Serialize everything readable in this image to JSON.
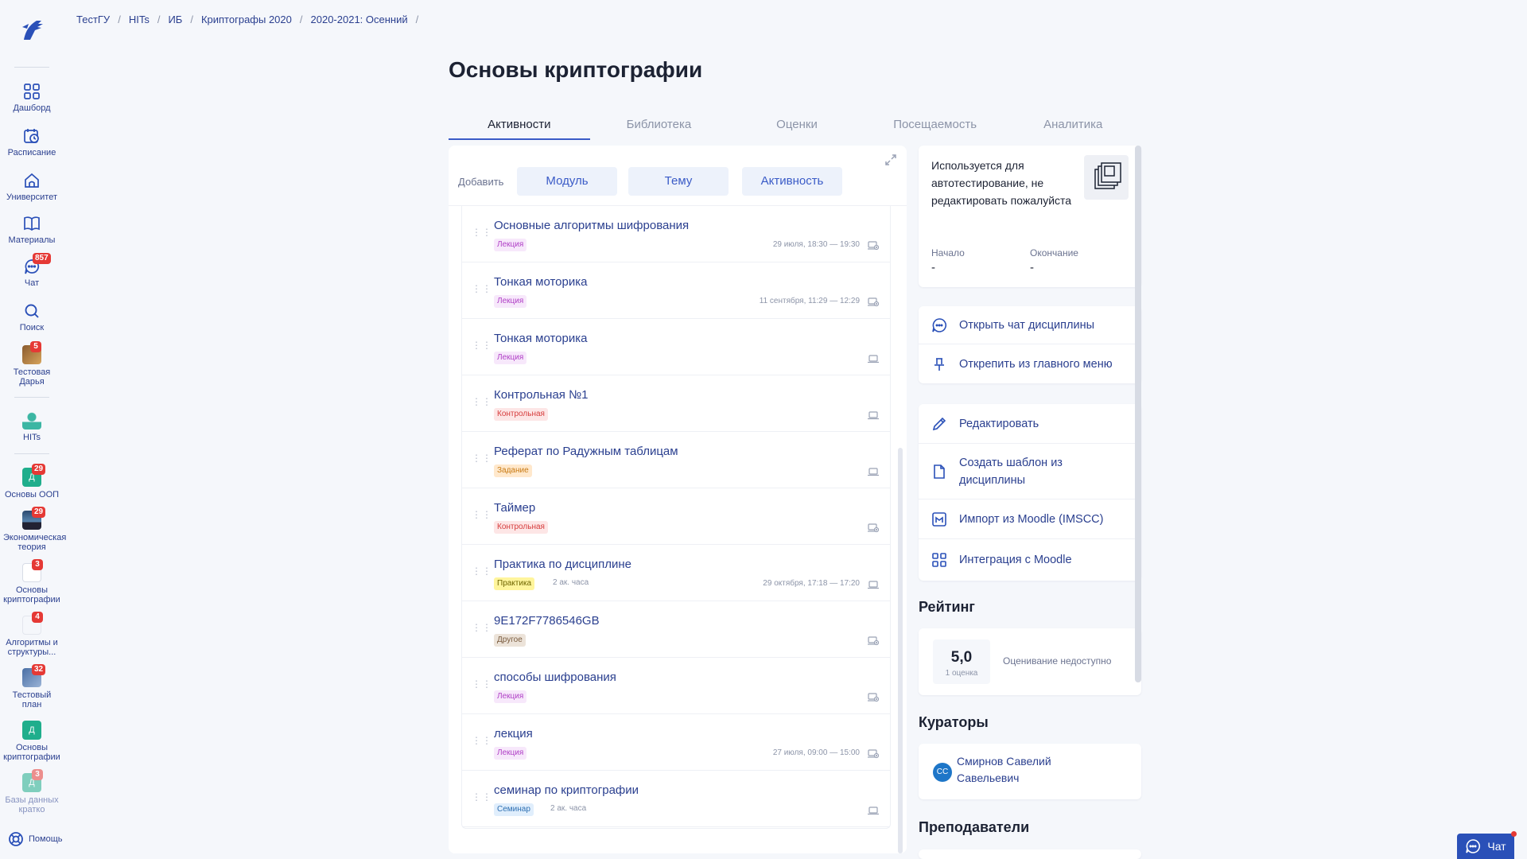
{
  "sidebar": {
    "items": [
      {
        "label": "Дашборд",
        "icon": "grid-icon"
      },
      {
        "label": "Расписание",
        "icon": "calendar-clock-icon"
      },
      {
        "label": "Университет",
        "icon": "university-icon"
      },
      {
        "label": "Материалы",
        "icon": "book-icon"
      },
      {
        "label": "Чат",
        "icon": "chat-icon",
        "badge": "857"
      },
      {
        "label": "Поиск",
        "icon": "search-icon"
      },
      {
        "label": "Тестовая Дарья",
        "icon": "user-avatar",
        "badge": "5"
      },
      {
        "label": "HITs",
        "icon": "hits-avatar"
      },
      {
        "label": "Основы ООП",
        "icon": "course-avatar",
        "badge": "29",
        "letter": "Д"
      },
      {
        "label": "Экономическая теория",
        "icon": "course-avatar",
        "badge": "29"
      },
      {
        "label": "Основы криптографии",
        "icon": "course-avatar",
        "badge": "3"
      },
      {
        "label": "Алгоритмы и структуры...",
        "icon": "course-avatar",
        "badge": "4"
      },
      {
        "label": "Тестовый план",
        "icon": "course-avatar",
        "badge": "32"
      },
      {
        "label": "Основы криптографии",
        "icon": "course-avatar",
        "letter": "Д"
      },
      {
        "label": "Базы данных кратко",
        "icon": "course-avatar",
        "badge": "3",
        "letter": "Д"
      }
    ],
    "help_label": "Помощь"
  },
  "breadcrumb": [
    "ТестГУ",
    "HITs",
    "ИБ",
    "Криптографы 2020",
    "2020-2021: Осенний"
  ],
  "page_title": "Основы криптографии",
  "tabs": [
    "Активности",
    "Библиотека",
    "Оценки",
    "Посещаемость",
    "Аналитика"
  ],
  "add_bar": {
    "label": "Добавить",
    "buttons": [
      "Модуль",
      "Тему",
      "Активность"
    ]
  },
  "activities": [
    {
      "title": "Основные алгоритмы шифрования",
      "tag": "Лекция",
      "tag_type": "lecture",
      "date": "29 июля, 18:30 — 19:30",
      "icon": "online-icon"
    },
    {
      "title": "Тонкая моторика",
      "tag": "Лекция",
      "tag_type": "lecture",
      "date": "11 сентября, 11:29 — 12:29",
      "icon": "online-icon"
    },
    {
      "title": "Тонкая моторика",
      "tag": "Лекция",
      "tag_type": "lecture",
      "date": "",
      "icon": "laptop-icon"
    },
    {
      "title": "Контрольная №1",
      "tag": "Контрольная",
      "tag_type": "control",
      "date": "",
      "icon": "laptop-icon"
    },
    {
      "title": "Реферат по Радужным таблицам",
      "tag": "Задание",
      "tag_type": "task",
      "date": "",
      "icon": "laptop-icon"
    },
    {
      "title": "Таймер",
      "tag": "Контрольная",
      "tag_type": "control",
      "date": "",
      "icon": "online-icon"
    },
    {
      "title": "Практика по дисциплине",
      "tag": "Практика",
      "tag_type": "practice",
      "hours": "2 ак. часа",
      "date": "29 октября, 17:18 — 17:20",
      "icon": "laptop-icon"
    },
    {
      "title": "9E172F7786546GB",
      "tag": "Другое",
      "tag_type": "other",
      "date": "",
      "icon": "online-icon"
    },
    {
      "title": "способы шифрования",
      "tag": "Лекция",
      "tag_type": "lecture",
      "date": "",
      "icon": "online-icon"
    },
    {
      "title": "лекция",
      "tag": "Лекция",
      "tag_type": "lecture",
      "date": "27 июля, 09:00 — 15:00",
      "icon": "online-icon"
    },
    {
      "title": "семинар по криптографии",
      "tag": "Семинар",
      "tag_type": "seminar",
      "hours": "2 ак. часа",
      "date": "",
      "icon": "laptop-icon"
    }
  ],
  "info_card": {
    "text": "Используется для автотестирование, не редактировать пожалуйста",
    "start_label": "Начало",
    "start_value": "-",
    "end_label": "Окончание",
    "end_value": "-"
  },
  "actions_1": [
    "Открыть чат дисциплины",
    "Открепить из главного меню"
  ],
  "actions_2": [
    "Редактировать",
    "Создать шаблон из дисциплины",
    "Импорт из Moodle (IMSCC)",
    "Интеграция с Moodle"
  ],
  "rating": {
    "heading": "Рейтинг",
    "value": "5,0",
    "count": "1 оценка",
    "status": "Оценивание недоступно"
  },
  "curators": {
    "heading": "Кураторы",
    "initials": "СС",
    "name": "Смирнов Савелий Савельевич"
  },
  "teachers_heading": "Преподаватели",
  "chat_fab_label": "Чат",
  "colors": {
    "accent": "#3a5bc7",
    "link": "#2a3f8f",
    "badge": "#e53935",
    "background": "#f5f7fb"
  }
}
